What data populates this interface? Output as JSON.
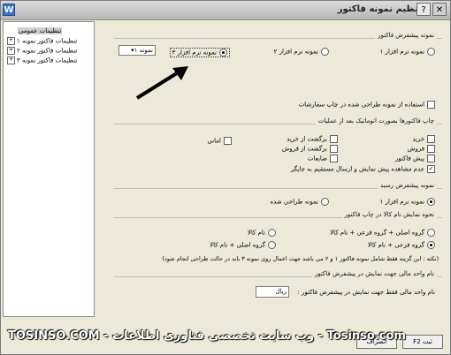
{
  "window": {
    "title": "تنظیم نمونه فاکتور",
    "close_glyph": "✕",
    "help_glyph": "?",
    "icon_glyph": "W"
  },
  "tree": {
    "items": [
      {
        "label": "تنظیمات عمومی",
        "expander": ""
      },
      {
        "label": "تنظیمات فاکتور نمونه ۱",
        "expander": "+"
      },
      {
        "label": "تنظیمات فاکتور نمونه ۲",
        "expander": "+"
      },
      {
        "label": "تنظیمات فاکتور نمونه ۳",
        "expander": "+"
      }
    ]
  },
  "print_sample": {
    "title": "نمونه پیشفرض فاکتور",
    "options": [
      "نمونه نرم افزار ۱",
      "نمونه نرم افزار ۲",
      "نمونه نرم افزار ۳",
      "نمونه ۱"
    ],
    "selected": "نمونه نرم افزار ۳",
    "use_designed": "استفاده از نمونه طراحی شده در چاپ سفارشات"
  },
  "auto_print": {
    "title": "چاپ فاکتورها بصورت اتوماتیک بعد از عملیات",
    "items": [
      "خرید",
      "فروش",
      "پیش فاکتور",
      "برگشت از خرید",
      "برگشت از فروش",
      "ضایعات",
      "امانی"
    ],
    "no_preview": "عدم مشاهده پیش نمایش و ارسال مستقیم به چاپگر"
  },
  "receipt": {
    "title": "نمونه پیشفرض رسید",
    "options": [
      "نمونه نرم افزار ۱",
      "نمونه طراحی شده"
    ]
  },
  "goods_name": {
    "title": "نحوه نمایش نام کالا در چاپ فاکتور",
    "options": [
      "گروه اصلی + گروه فرعی + نام کالا",
      "گروه فرعی + نام کالا",
      "نام کالا",
      "گروه اصلی + نام کالا"
    ],
    "note": "(نکته : این گزینه فقط شامل نمونه فاکتور ۱ و ۲ می باشد جهت اعمال روی نمونه ۳ باید در حالت طراحی انجام شود)"
  },
  "currency_unit": {
    "title": "نام واحد مالی جهت نمایش در پیشفرض فاکتور",
    "label": "نام واحد مالی فقط جهت نمایش در پیشفرض فاکتور :",
    "value": "ریال"
  },
  "footer": {
    "ok_label": "F2 ثبت",
    "cancel_label": "انصراف",
    "watermark": "TOSINSO.COM - وب سایت تخصصی فناوری اطلاعات - Tosinso.com"
  }
}
